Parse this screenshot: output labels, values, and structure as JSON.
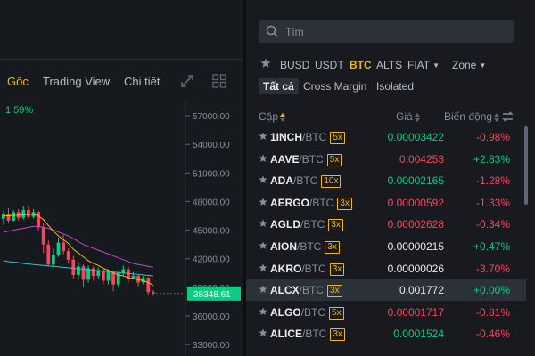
{
  "chart_panel": {
    "tabs": [
      {
        "label": "Gốc",
        "active": true
      },
      {
        "label": "Trading View",
        "active": false
      },
      {
        "label": "Chi tiết",
        "active": false
      }
    ],
    "change_pct": "1.59%",
    "icons": [
      "expand-icon",
      "grid-layout-icon"
    ]
  },
  "chart_data": {
    "type": "candlestick",
    "y_ticks": [
      57000,
      54000,
      51000,
      48000,
      45000,
      42000,
      39000,
      36000,
      33000
    ],
    "y_tick_labels": [
      "57000.00",
      "54000.00",
      "51000.00",
      "48000.00",
      "45000.00",
      "42000.00",
      "39000.00",
      "36000.00",
      "33000.00"
    ],
    "ylim": [
      31800,
      58500
    ],
    "last_price": 38348.61,
    "last_price_label": "38348.61",
    "candles": [
      {
        "o": 46200,
        "c": 46700,
        "h": 47000,
        "l": 45600
      },
      {
        "o": 46700,
        "c": 46000,
        "h": 47300,
        "l": 45700
      },
      {
        "o": 46000,
        "c": 46900,
        "h": 47100,
        "l": 45900
      },
      {
        "o": 46900,
        "c": 46300,
        "h": 47200,
        "l": 46000
      },
      {
        "o": 46300,
        "c": 47100,
        "h": 47500,
        "l": 46100
      },
      {
        "o": 47100,
        "c": 46400,
        "h": 47500,
        "l": 46200
      },
      {
        "o": 46400,
        "c": 46900,
        "h": 47200,
        "l": 46200
      },
      {
        "o": 46900,
        "c": 45300,
        "h": 47000,
        "l": 44900
      },
      {
        "o": 45300,
        "c": 43500,
        "h": 45800,
        "l": 42600
      },
      {
        "o": 43500,
        "c": 41400,
        "h": 43900,
        "l": 41200
      },
      {
        "o": 41400,
        "c": 42400,
        "h": 43100,
        "l": 41100
      },
      {
        "o": 42400,
        "c": 43700,
        "h": 44200,
        "l": 42200
      },
      {
        "o": 43700,
        "c": 42800,
        "h": 44500,
        "l": 42400
      },
      {
        "o": 42800,
        "c": 41900,
        "h": 43100,
        "l": 41500
      },
      {
        "o": 41900,
        "c": 40300,
        "h": 42300,
        "l": 39900
      },
      {
        "o": 40300,
        "c": 41200,
        "h": 41700,
        "l": 39800
      },
      {
        "o": 41200,
        "c": 39800,
        "h": 41400,
        "l": 39000
      },
      {
        "o": 39800,
        "c": 41000,
        "h": 41300,
        "l": 39500
      },
      {
        "o": 41000,
        "c": 40200,
        "h": 41200,
        "l": 39700
      },
      {
        "o": 40200,
        "c": 40800,
        "h": 41100,
        "l": 39900
      },
      {
        "o": 40800,
        "c": 39700,
        "h": 41000,
        "l": 39300
      },
      {
        "o": 39700,
        "c": 40600,
        "h": 40900,
        "l": 39300
      },
      {
        "o": 40600,
        "c": 39300,
        "h": 40700,
        "l": 38600
      },
      {
        "o": 39300,
        "c": 40500,
        "h": 40700,
        "l": 39000
      },
      {
        "o": 40500,
        "c": 40900,
        "h": 41300,
        "l": 40200
      },
      {
        "o": 40900,
        "c": 39900,
        "h": 41200,
        "l": 39500
      },
      {
        "o": 39900,
        "c": 40200,
        "h": 40600,
        "l": 39800
      },
      {
        "o": 40200,
        "c": 39500,
        "h": 40300,
        "l": 39100
      },
      {
        "o": 39500,
        "c": 40000,
        "h": 40200,
        "l": 39300
      },
      {
        "o": 40000,
        "c": 38500,
        "h": 40100,
        "l": 38200
      },
      {
        "o": 38500,
        "c": 38348,
        "h": 38700,
        "l": 38100
      }
    ],
    "ma_short": [
      46500,
      46500,
      46550,
      46550,
      46600,
      46650,
      46650,
      46500,
      46100,
      45500,
      44900,
      44400,
      44000,
      43600,
      43000,
      42600,
      42200,
      41800,
      41500,
      41300,
      41000,
      40800,
      40500,
      40300,
      40200,
      40000,
      39900,
      39800,
      39700,
      39500,
      39200
    ],
    "ma_long": [
      44800,
      44900,
      45000,
      45100,
      45200,
      45300,
      45400,
      45400,
      45300,
      45200,
      45000,
      44800,
      44600,
      44400,
      44100,
      43800,
      43500,
      43300,
      43100,
      42900,
      42700,
      42500,
      42300,
      42100,
      41900,
      41700,
      41500,
      41400,
      41300,
      41200,
      41100
    ],
    "ma_teal": [
      41800,
      41700,
      41650,
      41600,
      41500,
      41450,
      41400,
      41350,
      41300,
      41250,
      41200,
      41150,
      41100,
      41050,
      41000,
      40950,
      40900,
      40850,
      40800,
      40750,
      40700,
      40650,
      40600,
      40550,
      40500,
      40450,
      40400,
      40350,
      40300,
      40250,
      40200
    ],
    "colors": {
      "up": "#0ecb81",
      "down": "#f6465d",
      "ma_short": "#f0b90b",
      "ma_long": "#c545c9",
      "ma_teal": "#2ec7c9",
      "axis_text": "#848e9c",
      "last_price_bg": "#0ecb81"
    }
  },
  "market": {
    "search": {
      "placeholder": "Tìm",
      "value": ""
    },
    "quote_tabs": [
      {
        "label": "BUSD",
        "active": false,
        "dropdown": false
      },
      {
        "label": "USDT",
        "active": false,
        "dropdown": false
      },
      {
        "label": "BTC",
        "active": true,
        "dropdown": false
      },
      {
        "label": "ALTS",
        "active": false,
        "dropdown": false
      },
      {
        "label": "FIAT",
        "active": false,
        "dropdown": true
      },
      {
        "label": "Zone",
        "active": false,
        "dropdown": true
      }
    ],
    "sub_tabs": [
      {
        "label": "Tất cả",
        "active": true
      },
      {
        "label": "Cross Margin",
        "active": false
      },
      {
        "label": "Isolated",
        "active": false
      }
    ],
    "headers": {
      "pair": "Cặp",
      "price": "Giá",
      "change": "Biến động"
    },
    "rows": [
      {
        "base": "1INCH",
        "quote": "/BTC",
        "lev": "5x",
        "price": "0.00003422",
        "price_dir": "up",
        "change": "-0.98%",
        "change_dir": "down"
      },
      {
        "base": "AAVE",
        "quote": "/BTC",
        "lev": "5x",
        "price": "0.004253",
        "price_dir": "down",
        "change": "+2.83%",
        "change_dir": "up"
      },
      {
        "base": "ADA",
        "quote": "/BTC",
        "lev": "10x",
        "price": "0.00002165",
        "price_dir": "up",
        "change": "-1.28%",
        "change_dir": "down"
      },
      {
        "base": "AERGO",
        "quote": "/BTC",
        "lev": "3x",
        "price": "0.00000592",
        "price_dir": "down",
        "change": "-1.33%",
        "change_dir": "down"
      },
      {
        "base": "AGLD",
        "quote": "/BTC",
        "lev": "3x",
        "price": "0.00002628",
        "price_dir": "down",
        "change": "-0.34%",
        "change_dir": "down"
      },
      {
        "base": "AION",
        "quote": "/BTC",
        "lev": "3x",
        "price": "0.00000215",
        "price_dir": "flat",
        "change": "+0.47%",
        "change_dir": "up"
      },
      {
        "base": "AKRO",
        "quote": "/BTC",
        "lev": "3x",
        "price": "0.00000026",
        "price_dir": "flat",
        "change": "-3.70%",
        "change_dir": "down"
      },
      {
        "base": "ALCX",
        "quote": "/BTC",
        "lev": "3x",
        "price": "0.001772",
        "price_dir": "flat",
        "change": "+0.00%",
        "change_dir": "up",
        "highlight": true
      },
      {
        "base": "ALGO",
        "quote": "/BTC",
        "lev": "5x",
        "price": "0.00001717",
        "price_dir": "down",
        "change": "-0.81%",
        "change_dir": "down"
      },
      {
        "base": "ALICE",
        "quote": "/BTC",
        "lev": "3x",
        "price": "0.0001524",
        "price_dir": "up",
        "change": "-0.46%",
        "change_dir": "down"
      }
    ],
    "colors": {
      "accent": "#f0b90b",
      "up": "#0ecb81",
      "down": "#f6465d",
      "muted": "#848e9c"
    }
  }
}
